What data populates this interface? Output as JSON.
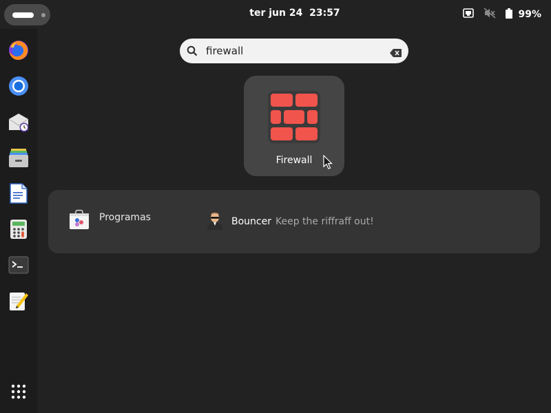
{
  "topbar": {
    "date": "ter jun 24",
    "time": "23:57",
    "battery_percent": "99%"
  },
  "dock": {
    "items": [
      {
        "icon": "firefox-icon"
      },
      {
        "icon": "chromium-icon"
      },
      {
        "icon": "mail-icon"
      },
      {
        "icon": "archive-manager-icon"
      },
      {
        "icon": "document-writer-icon"
      },
      {
        "icon": "calculator-icon"
      },
      {
        "icon": "terminal-icon"
      },
      {
        "icon": "text-editor-icon"
      }
    ],
    "apps_grid_icon": "app-grid-icon"
  },
  "search": {
    "value": "firewall"
  },
  "apps": [
    {
      "label": "Firewall",
      "icon": "firewall-icon",
      "color": "#f0544c"
    }
  ],
  "provider_results": {
    "provider_label": "Programas",
    "items": [
      {
        "name": "Bouncer",
        "description": "Keep the riffraff out!"
      }
    ]
  }
}
